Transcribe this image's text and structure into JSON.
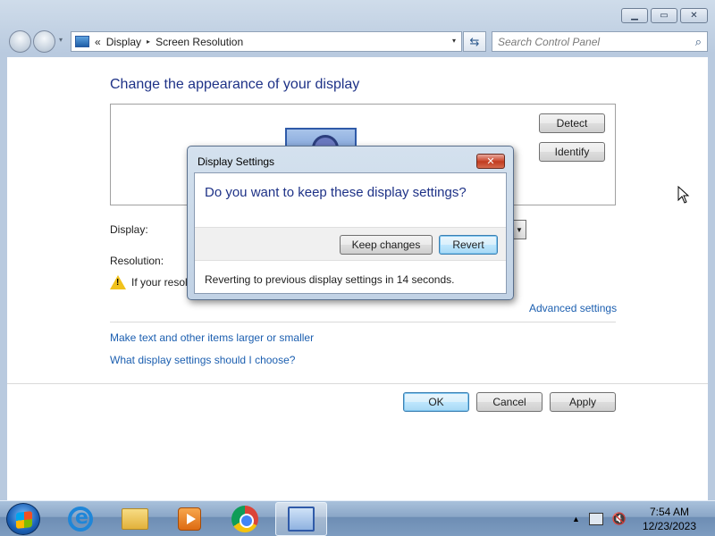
{
  "window": {
    "controls": {
      "minimize": "▁",
      "maximize": "▭",
      "close": "✕"
    }
  },
  "nav": {
    "breadcrumb_prefix": "«",
    "crumbs": [
      "Display",
      "Screen Resolution"
    ],
    "separator": "▸",
    "address_dropdown": "▾",
    "refresh_icon": "⇆",
    "search_placeholder": "Search Control Panel",
    "search_icon": "⌕"
  },
  "page": {
    "title": "Change the appearance of your display",
    "detect_label": "Detect",
    "identify_label": "Identify",
    "display_label": "Display:",
    "resolution_label": "Resolution:",
    "warning_text": "If your resol",
    "advanced_link": "Advanced settings",
    "link_text_size": "Make text and other items larger or smaller",
    "link_help": "What display settings should I choose?",
    "ok_label": "OK",
    "cancel_label": "Cancel",
    "apply_label": "Apply"
  },
  "dialog": {
    "title": "Display Settings",
    "close_glyph": "✕",
    "question": "Do you want to keep these display settings?",
    "keep_label": "Keep changes",
    "revert_label": "Revert",
    "status": "Reverting to previous display settings in 14 seconds."
  },
  "taskbar": {
    "items": [
      "start-button",
      "internet-explorer",
      "windows-explorer",
      "media-player",
      "chrome",
      "control-panel"
    ],
    "tray_arrow": "▲",
    "clock_time": "7:54 AM",
    "clock_date": "12/23/2023"
  },
  "colors": {
    "link": "#1c5fb0",
    "heading": "#1e3287",
    "accent_button_border": "#3c7fb1"
  }
}
